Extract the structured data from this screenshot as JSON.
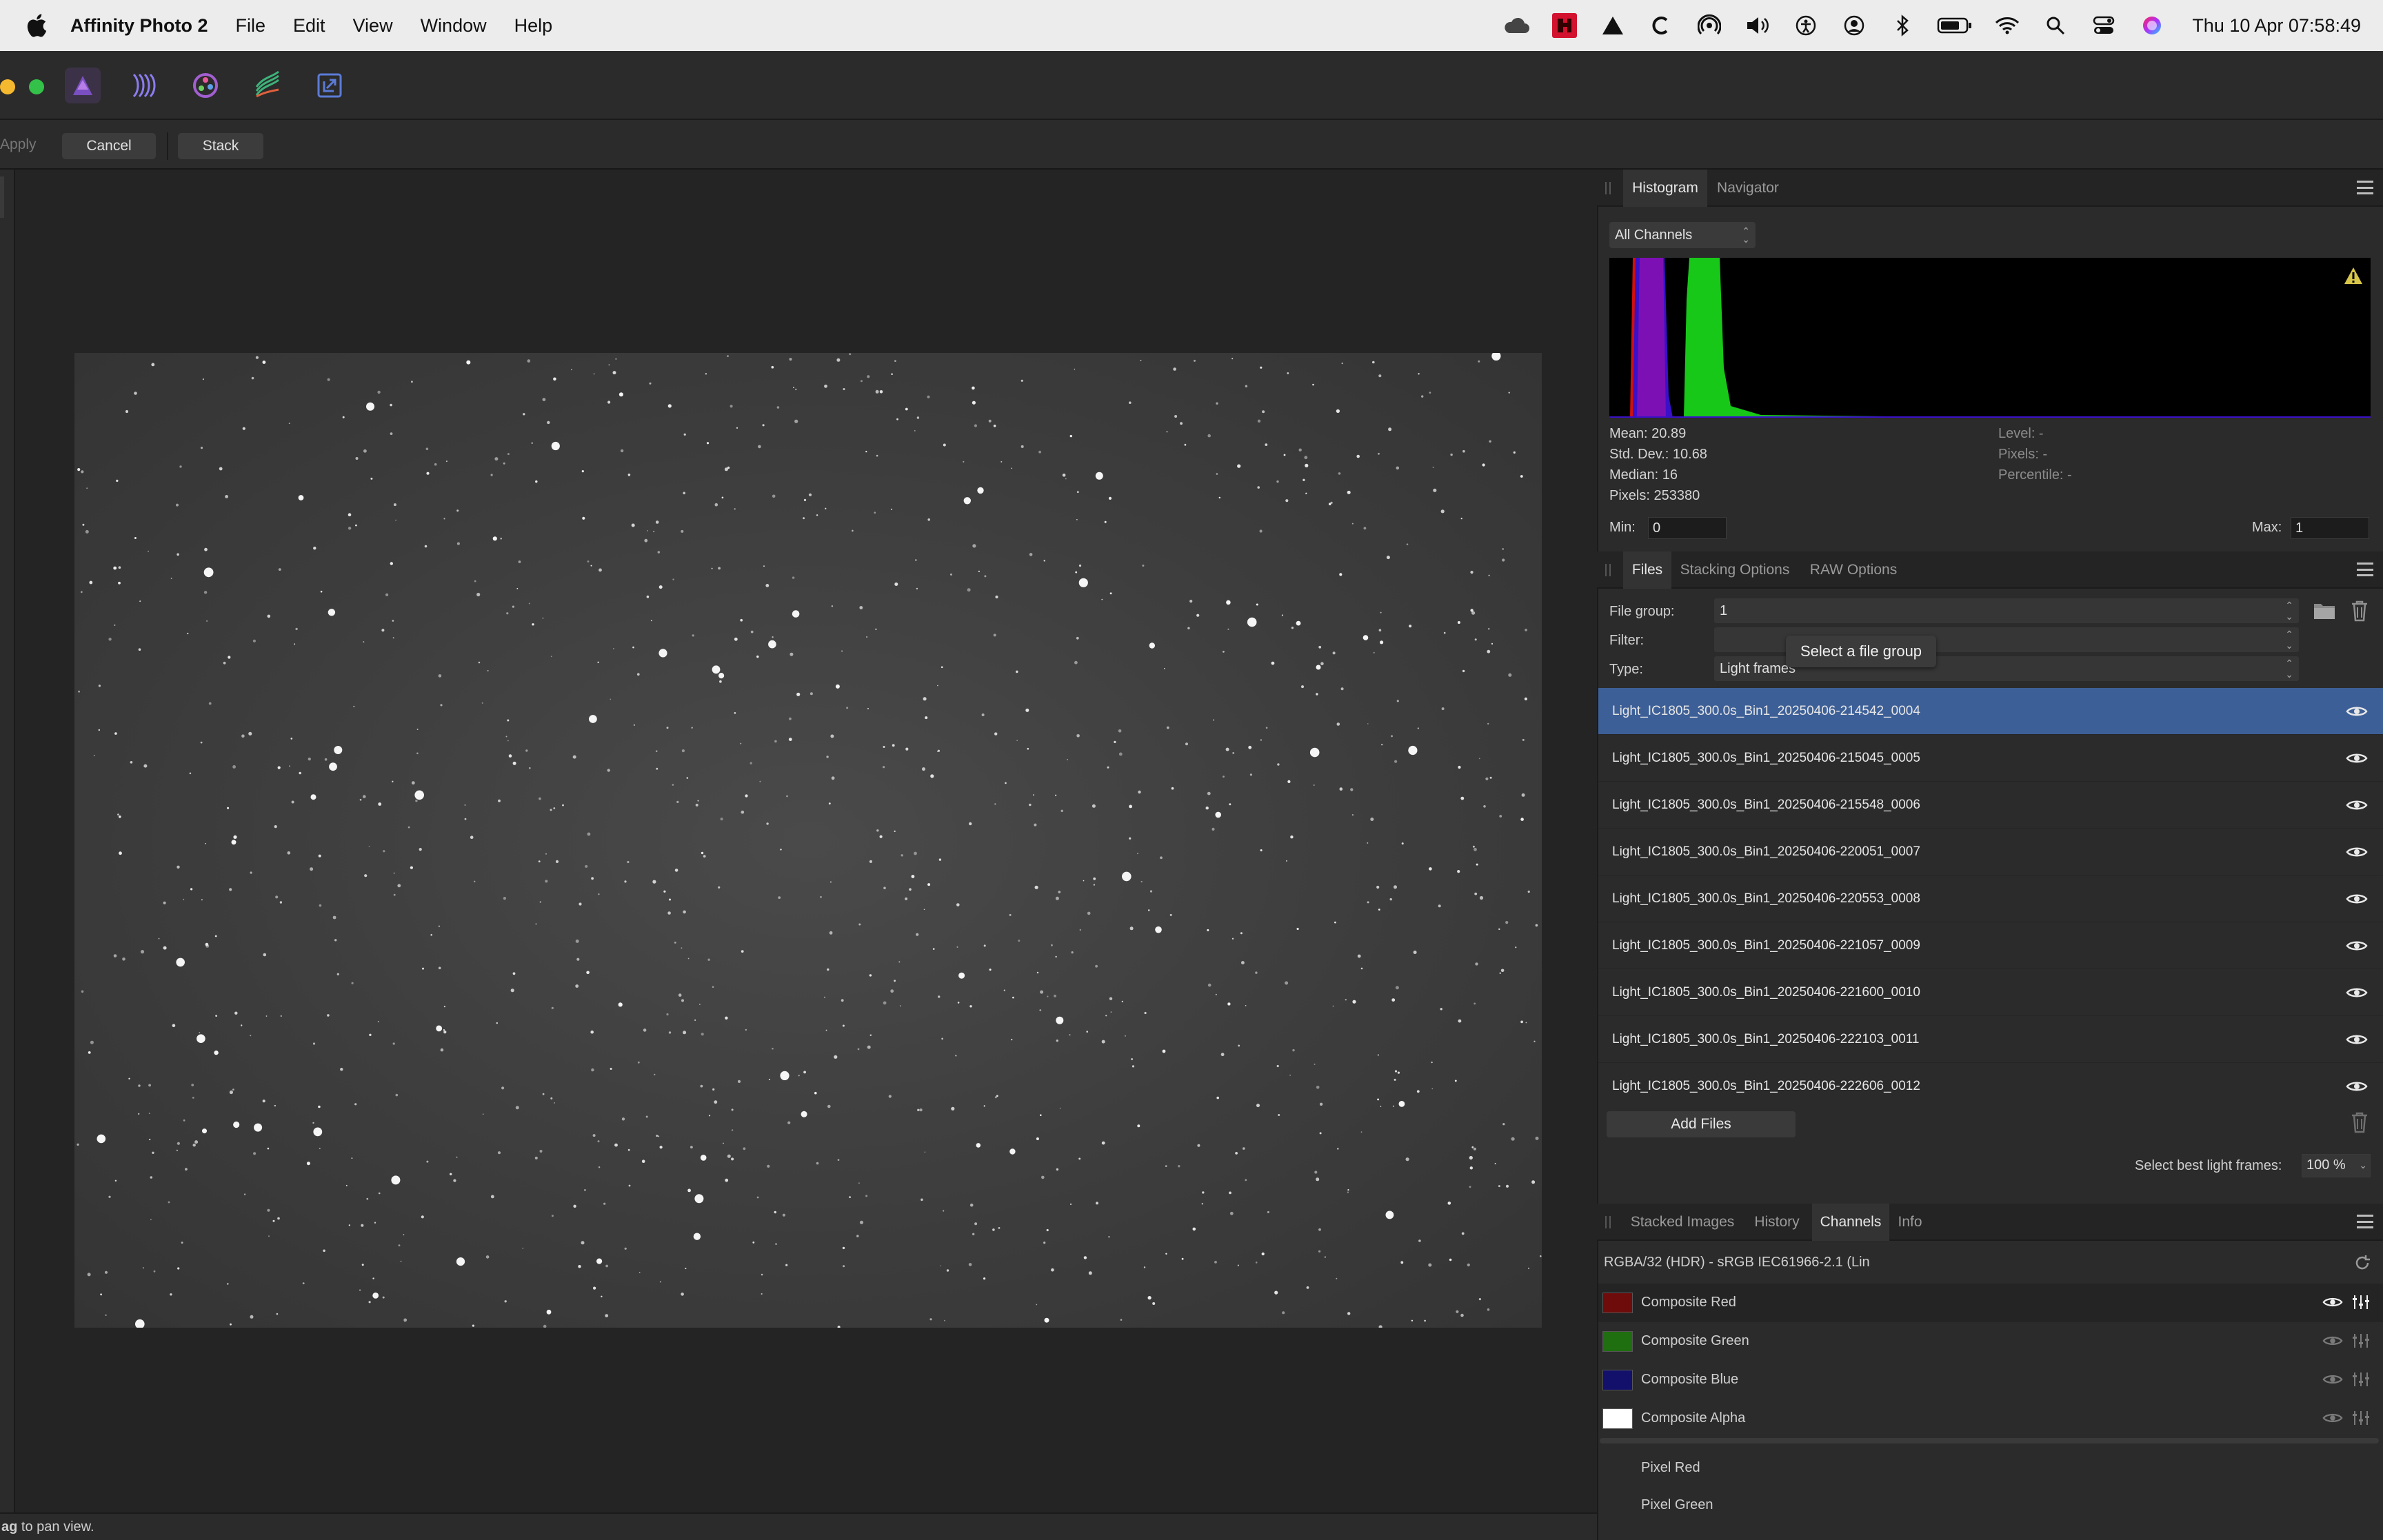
{
  "menubar": {
    "app_name": "Affinity Photo 2",
    "menus": [
      "File",
      "Edit",
      "View",
      "Window",
      "Help"
    ],
    "clock": "Thu 10 Apr  07:58:49",
    "status_icons": [
      "cloud-icon",
      "app-red-icon",
      "triangle-icon",
      "c-icon",
      "airdrop-icon",
      "volume-icon",
      "accessibility-icon",
      "user-icon",
      "bluetooth-icon",
      "battery-icon",
      "wifi-icon",
      "spotlight-icon",
      "control-center-icon",
      "siri-icon"
    ]
  },
  "toolbar": {
    "personas": [
      "photo-persona-icon",
      "liquify-persona-icon",
      "develop-persona-icon",
      "tone-mapping-persona-icon",
      "export-persona-icon"
    ]
  },
  "context_bar": {
    "apply_label": "Apply",
    "cancel_label": "Cancel",
    "stack_label": "Stack"
  },
  "status_bar": {
    "hint_bold": "ag",
    "hint_text": " to pan view."
  },
  "histogram_panel": {
    "tabs": [
      "Histogram",
      "Navigator"
    ],
    "active_tab": "Histogram",
    "channel_select": "All Channels",
    "warning": "warning-icon",
    "stats_left": [
      "Mean: 20.89",
      "Std. Dev.: 10.68",
      "Median: 16",
      "Pixels: 253380"
    ],
    "stats_right": [
      "Level: -",
      "Pixels: -",
      "Percentile: -"
    ],
    "min_label": "Min:",
    "min_value": "0",
    "max_label": "Max:",
    "max_value": "1",
    "colors": {
      "red": "#d01010",
      "blue": "#3a10c8",
      "purple": "#8a10b0",
      "green": "#18c818"
    }
  },
  "files_panel": {
    "tabs": [
      "Files",
      "Stacking Options",
      "RAW Options"
    ],
    "active_tab": "Files",
    "file_group_label": "File group:",
    "file_group_value": "1",
    "filter_label": "Filter:",
    "filter_value": "",
    "type_label": "Type:",
    "type_value": "Light frames",
    "tooltip": "Select a file group",
    "files": [
      "Light_IC1805_300.0s_Bin1_20250406-214542_0004",
      "Light_IC1805_300.0s_Bin1_20250406-215045_0005",
      "Light_IC1805_300.0s_Bin1_20250406-215548_0006",
      "Light_IC1805_300.0s_Bin1_20250406-220051_0007",
      "Light_IC1805_300.0s_Bin1_20250406-220553_0008",
      "Light_IC1805_300.0s_Bin1_20250406-221057_0009",
      "Light_IC1805_300.0s_Bin1_20250406-221600_0010",
      "Light_IC1805_300.0s_Bin1_20250406-222103_0011",
      "Light_IC1805_300.0s_Bin1_20250406-222606_0012"
    ],
    "selected_index": 0,
    "add_files_label": "Add Files",
    "best_frames_label": "Select best light frames:",
    "best_frames_value": "100 %"
  },
  "channels_panel": {
    "tabs": [
      "Stacked Images",
      "History",
      "Channels",
      "Info"
    ],
    "active_tab": "Channels",
    "format": "RGBA/32 (HDR) - sRGB IEC61966-2.1 (Lin",
    "composite": [
      {
        "name": "Composite Red",
        "color": "#6e0c0c"
      },
      {
        "name": "Composite Green",
        "color": "#1f6e10"
      },
      {
        "name": "Composite Blue",
        "color": "#12106a"
      },
      {
        "name": "Composite Alpha",
        "color": "#ffffff"
      }
    ],
    "pixel": [
      "Pixel Red",
      "Pixel Green"
    ]
  }
}
